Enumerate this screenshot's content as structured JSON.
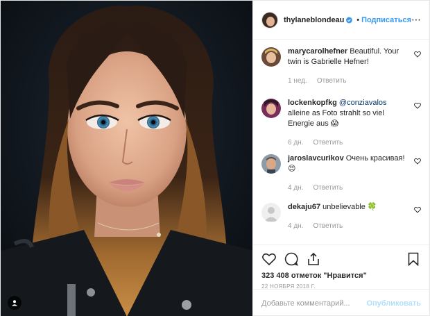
{
  "post": {
    "username": "thylaneblondeau",
    "separator": "•",
    "follow_label": "Подписаться",
    "more_label": "⋯",
    "verified_icon": "verified-badge-icon"
  },
  "comments": [
    {
      "user": "marycarolhefner",
      "text": "Beautiful. Your twin is Gabrielle Hefner!",
      "mention": "",
      "age": "1 нед.",
      "reply": "Ответить"
    },
    {
      "user": "lockenkopfkg",
      "mention": "@conziavalos",
      "text": "alleine as Foto strahlt so viel Energie aus 😱",
      "age": "6 дн.",
      "reply": "Ответить"
    },
    {
      "user": "jaroslavcurikov",
      "text": "Очень красивая! 😍",
      "mention": "",
      "age": "4 дн.",
      "reply": "Ответить"
    },
    {
      "user": "dekaju67",
      "text": "unbelievable 🍀",
      "mention": "",
      "age": "4 дн.",
      "reply": "Ответить"
    }
  ],
  "actions": {
    "likes": "323 408 отметок \"Нравится\"",
    "date": "22 ноября 2018 г."
  },
  "composer": {
    "placeholder": "Добавьте комментарий...",
    "publish_label": "Опубликовать"
  },
  "colors": {
    "accent": "#3897f0",
    "publish_disabled": "#b2dffc",
    "muted": "#999999",
    "text": "#262626"
  }
}
